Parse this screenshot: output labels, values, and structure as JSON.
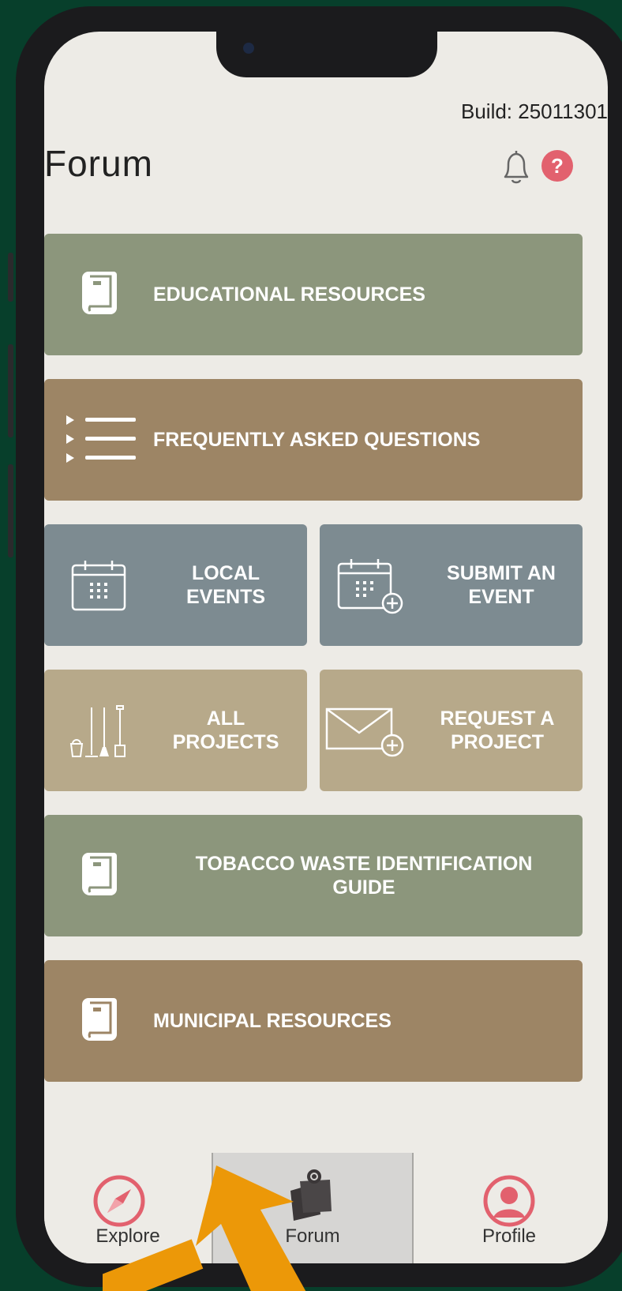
{
  "status": {
    "build_text": "Build: 25011301"
  },
  "header": {
    "title": "Forum",
    "bell_icon": "bell-icon",
    "help_icon": "help-icon",
    "help_label": "?"
  },
  "tiles": {
    "educational": {
      "label": "EDUCATIONAL RESOURCES",
      "icon": "book-icon",
      "color": "#8c967c"
    },
    "faq": {
      "label": "FREQUENTLY ASKED QUESTIONS",
      "icon": "list-icon",
      "color": "#9d8565"
    },
    "local_events": {
      "line1": "LOCAL",
      "line2": "EVENTS",
      "icon": "calendar-icon",
      "color": "#7d8b91"
    },
    "submit_event": {
      "line1": "SUBMIT AN",
      "line2": "EVENT",
      "icon": "calendar-add-icon",
      "color": "#7d8b91"
    },
    "all_projects": {
      "line1": "ALL",
      "line2": "PROJECTS",
      "icon": "cleaning-tools-icon",
      "color": "#b7a98a"
    },
    "request_project": {
      "line1": "REQUEST A",
      "line2": "PROJECT",
      "icon": "envelope-add-icon",
      "color": "#b7a98a"
    },
    "tobacco": {
      "line1": "TOBACCO WASTE IDENTIFICATION",
      "line2": "GUIDE",
      "icon": "book-icon",
      "color": "#8c967c"
    },
    "municipal": {
      "label": "MUNICIPAL RESOURCES",
      "icon": "book-icon",
      "color": "#9d8565"
    }
  },
  "nav": {
    "explore": {
      "label": "Explore",
      "icon": "compass-icon"
    },
    "forum": {
      "label": "Forum",
      "icon": "notes-pin-icon",
      "active": true
    },
    "profile": {
      "label": "Profile",
      "icon": "user-circle-icon"
    }
  },
  "annotation": {
    "icon": "arrow-pointer",
    "color": "#ec9808"
  }
}
